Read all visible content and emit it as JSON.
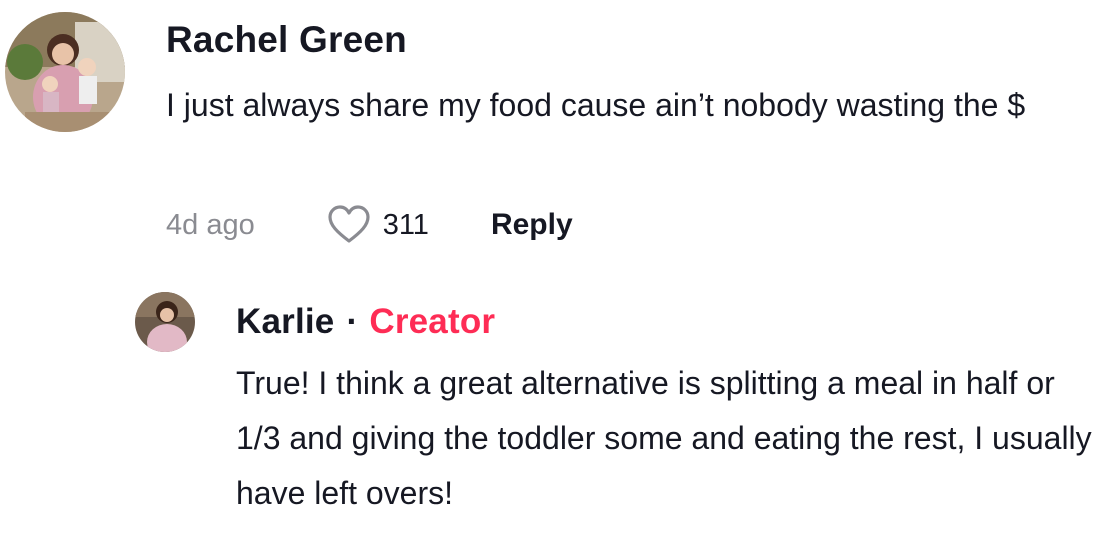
{
  "comments": [
    {
      "author": "Rachel Green",
      "avatar_icon": "user-photo-avatar",
      "text": "I just always share my food cause ain’t nobody wasting the $",
      "time": "4d ago",
      "like_icon": "heart-outline-icon",
      "likes": "311",
      "reply_label": "Reply"
    }
  ],
  "reply": {
    "author": "Karlie",
    "separator": "·",
    "badge": "Creator",
    "avatar_icon": "user-photo-avatar",
    "text": "True! I think a great alternative is splitting a meal in half or 1/3 and giving the toddler some and eating the rest, I usually have left overs!"
  },
  "colors": {
    "text": "#161823",
    "muted": "#8a8b91",
    "creator": "#fe2c55"
  }
}
